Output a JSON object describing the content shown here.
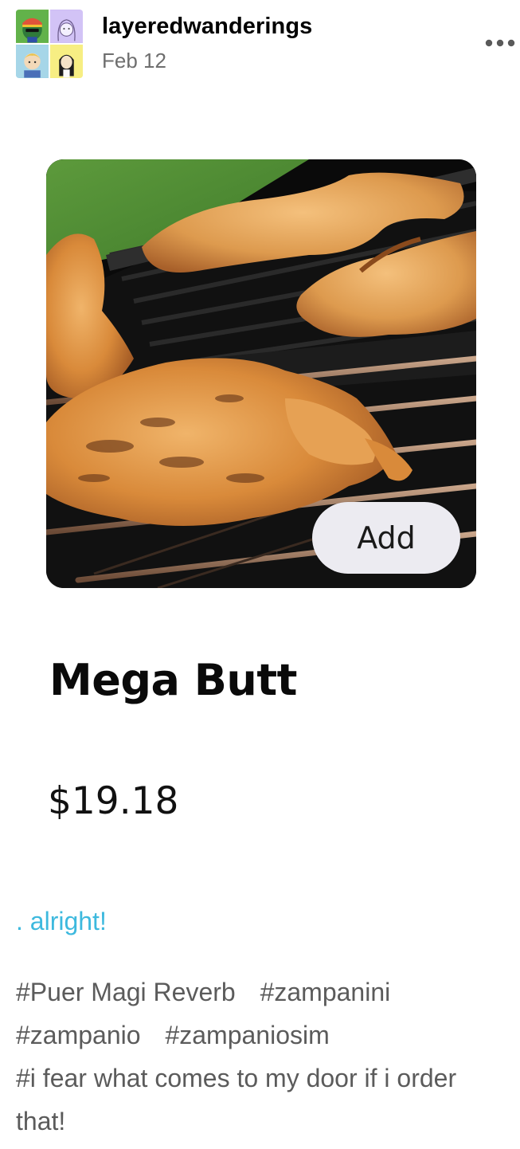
{
  "header": {
    "blog_name": "layeredwanderings",
    "date": "Feb 12",
    "more_icon": "ellipsis-icon"
  },
  "product": {
    "title": "Mega Butt",
    "price": "$19.18",
    "add_label": "Add"
  },
  "caption": ". alright!",
  "tags": [
    "#Puer Magi Reverb",
    "#zampanini",
    "#zampanio",
    "#zampaniosim",
    "#i fear what comes to my door if i order that!"
  ],
  "colors": {
    "caption_link": "#3db9de",
    "tag_text": "#5b5b5b",
    "date_text": "#6e6e6e"
  }
}
